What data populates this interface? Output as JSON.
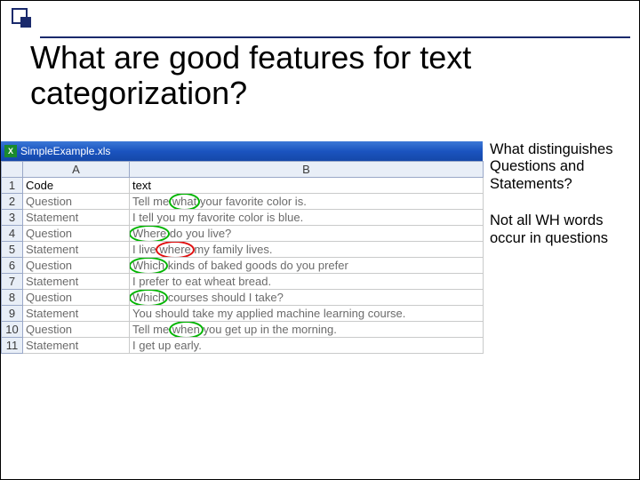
{
  "title": "What are good features for text categorization?",
  "titlebar": {
    "filename": "SimpleExample.xls",
    "icon_label": "X"
  },
  "columns": {
    "A": "A",
    "B": "B"
  },
  "header_row": {
    "code": "Code",
    "text": "text"
  },
  "rows": [
    {
      "n": "1"
    },
    {
      "n": "2",
      "code": "Question",
      "pre": "Tell me ",
      "hi": "what",
      "post": " your favorite color is.",
      "hi_kind": "green"
    },
    {
      "n": "3",
      "code": "Statement",
      "pre": "I tell you my favorite color is blue.",
      "hi": "",
      "post": "",
      "hi_kind": ""
    },
    {
      "n": "4",
      "code": "Question",
      "pre": "",
      "hi": "Where",
      "post": " do you live?",
      "hi_kind": "green"
    },
    {
      "n": "5",
      "code": "Statement",
      "pre": "I live ",
      "hi": "where",
      "post": " my family lives.",
      "hi_kind": "red"
    },
    {
      "n": "6",
      "code": "Question",
      "pre": "",
      "hi": "Which",
      "post": " kinds of baked goods do you prefer",
      "hi_kind": "green"
    },
    {
      "n": "7",
      "code": "Statement",
      "pre": "I prefer to eat wheat bread.",
      "hi": "",
      "post": "",
      "hi_kind": ""
    },
    {
      "n": "8",
      "code": "Question",
      "pre": "",
      "hi": "Which",
      "post": " courses should I take?",
      "hi_kind": "green"
    },
    {
      "n": "9",
      "code": "Statement",
      "pre": "You should take my applied machine learning course.",
      "hi": "",
      "post": "",
      "hi_kind": ""
    },
    {
      "n": "10",
      "code": "Question",
      "pre": "Tell me ",
      "hi": "when",
      "post": " you get up in the morning.",
      "hi_kind": "green"
    },
    {
      "n": "11",
      "code": "Statement",
      "pre": "I get up early.",
      "hi": "",
      "post": "",
      "hi_kind": ""
    }
  ],
  "side": {
    "p1": "What distinguishes Questions and Statements?",
    "p2": "Not all WH words occur in questions"
  }
}
